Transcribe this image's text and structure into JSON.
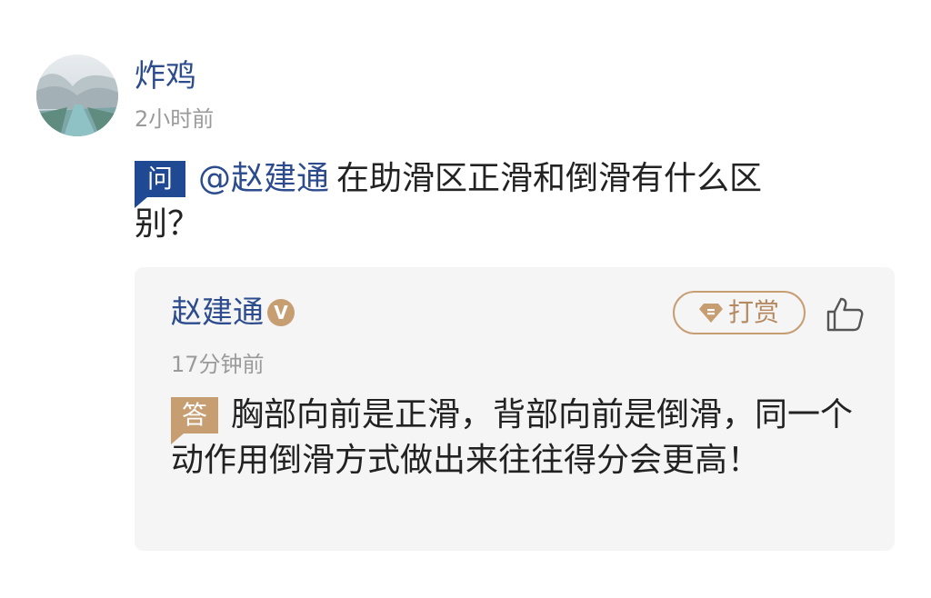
{
  "question": {
    "author": "炸鸡",
    "time": "2小时前",
    "badge": "问",
    "mention": "@赵建通",
    "text": "在助滑区正滑和倒滑有什么区别？"
  },
  "answer": {
    "author": "赵建通",
    "verified_badge": "V",
    "reward_label": "打赏",
    "time": "17分钟前",
    "badge": "答",
    "text": "胸部向前是正滑，背部向前是倒滑，同一个动作用倒滑方式做出来往往得分会更高！"
  },
  "icons": {
    "avatar": "avatar-image",
    "reward": "diamond-coin-icon",
    "like": "thumbs-up-icon"
  },
  "colors": {
    "name_blue": "#2d4c8e",
    "question_badge": "#1f4a93",
    "answer_gold": "#c79d72",
    "time_gray": "#9a9a9a",
    "card_bg": "#f5f5f5"
  }
}
